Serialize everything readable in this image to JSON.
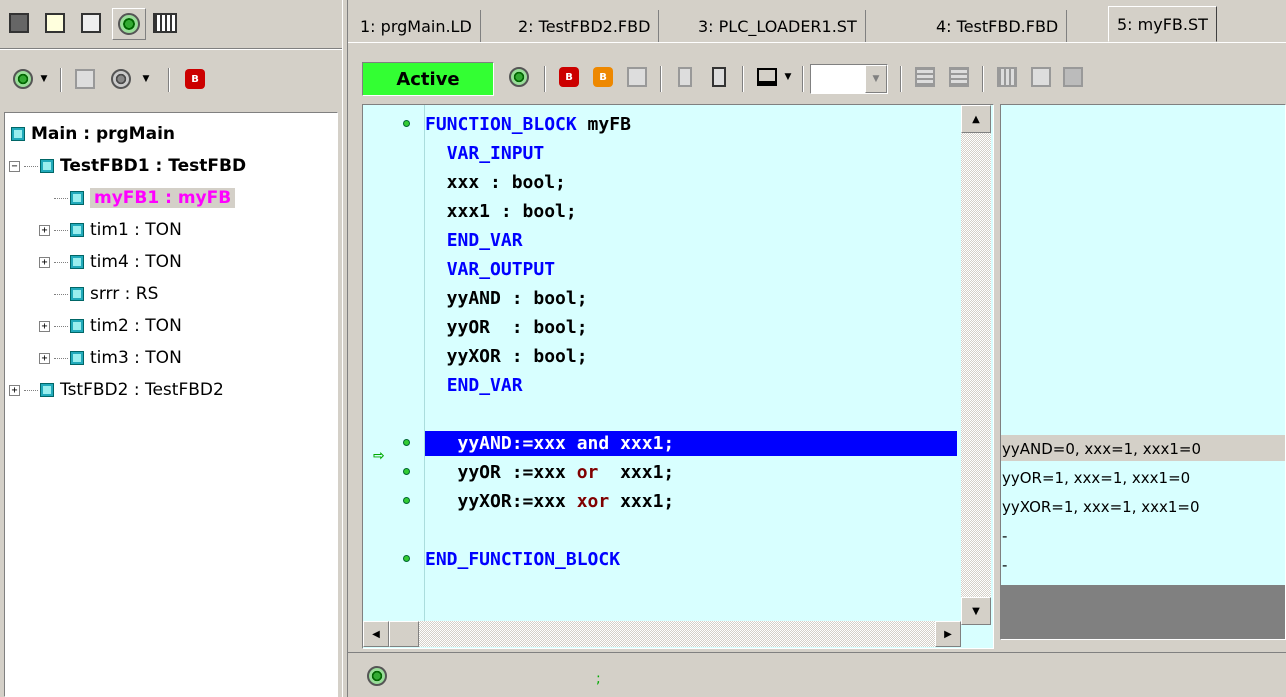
{
  "left_toolbar": {
    "icons": [
      "pages-icon",
      "copy-icon",
      "folder-icon",
      "debug-bug-icon",
      "iec-icon"
    ]
  },
  "left_toolbar2": {
    "icons": [
      "new-instance-icon",
      "dropdown-arrow",
      "instance-icon",
      "instance2-icon",
      "dropdown-arrow",
      "build-icon"
    ]
  },
  "tree": {
    "items": [
      {
        "label": "Main : prgMain",
        "bold": true,
        "indent": 0,
        "expander": ""
      },
      {
        "label": "TestFBD1 : TestFBD",
        "bold": true,
        "indent": 0,
        "expander": "−"
      },
      {
        "label": "myFB1 : myFB",
        "bold": true,
        "indent": 1,
        "expander": "",
        "highlight": true
      },
      {
        "label": "tim1 : TON",
        "indent": 1,
        "expander": "+"
      },
      {
        "label": "tim4 : TON",
        "indent": 1,
        "expander": "+"
      },
      {
        "label": "srrr : RS",
        "indent": 1,
        "expander": ""
      },
      {
        "label": "tim2 : TON",
        "indent": 1,
        "expander": "+"
      },
      {
        "label": "tim3 : TON",
        "indent": 1,
        "expander": "+"
      },
      {
        "label": "TstFBD2 : TestFBD2",
        "indent": 0,
        "expander": "+"
      }
    ]
  },
  "tabs": [
    {
      "label": "1: prgMain.LD",
      "active": false
    },
    {
      "label": "2: TestFBD2.FBD",
      "active": false
    },
    {
      "label": "3: PLC_LOADER1.ST",
      "active": false
    },
    {
      "label": "4: TestFBD.FBD",
      "active": false
    },
    {
      "label": "5: myFB.ST",
      "active": true
    }
  ],
  "toolbar": {
    "status_label": "Active",
    "status_color": "#33ff33"
  },
  "code": {
    "lines": [
      {
        "tokens": [
          [
            "kw",
            "FUNCTION_BLOCK"
          ],
          [
            "n",
            " myFB"
          ]
        ],
        "dot": true
      },
      {
        "tokens": [
          [
            "n",
            "  "
          ],
          [
            "kw",
            "VAR_INPUT"
          ]
        ]
      },
      {
        "tokens": [
          [
            "n",
            "  xxx : bool;"
          ]
        ]
      },
      {
        "tokens": [
          [
            "n",
            "  xxx1 : bool;"
          ]
        ]
      },
      {
        "tokens": [
          [
            "n",
            "  "
          ],
          [
            "kw",
            "END_VAR"
          ]
        ]
      },
      {
        "tokens": [
          [
            "n",
            "  "
          ],
          [
            "kw",
            "VAR_OUTPUT"
          ]
        ]
      },
      {
        "tokens": [
          [
            "n",
            "  yyAND : bool;"
          ]
        ]
      },
      {
        "tokens": [
          [
            "n",
            "  yyOR  : bool;"
          ]
        ]
      },
      {
        "tokens": [
          [
            "n",
            "  yyXOR : bool;"
          ]
        ]
      },
      {
        "tokens": [
          [
            "n",
            "  "
          ],
          [
            "kw",
            "END_VAR"
          ]
        ]
      },
      {
        "tokens": []
      },
      {
        "tokens": [
          [
            "n",
            "   yyAND:=xxx and xxx1;"
          ]
        ],
        "dot": true,
        "current": true
      },
      {
        "tokens": [
          [
            "n",
            "   yyOR :=xxx "
          ],
          [
            "kw2",
            "or"
          ],
          [
            "n",
            "  xxx1;"
          ]
        ],
        "dot": true
      },
      {
        "tokens": [
          [
            "n",
            "   yyXOR:=xxx "
          ],
          [
            "kw2",
            "xor"
          ],
          [
            "n",
            " xxx1;"
          ]
        ],
        "dot": true
      },
      {
        "tokens": []
      },
      {
        "tokens": [
          [
            "kw",
            "END_FUNCTION_BLOCK"
          ]
        ],
        "dot": true
      }
    ]
  },
  "monitor": {
    "lines": [
      "yyAND=0, xxx=1, xxx1=0",
      "yyOR=1, xxx=1, xxx1=0",
      "yyXOR=1, xxx=1, xxx1=0",
      "-",
      "-"
    ]
  },
  "statusbar": {
    "icon": "debug-bug-icon",
    "text": ";"
  }
}
